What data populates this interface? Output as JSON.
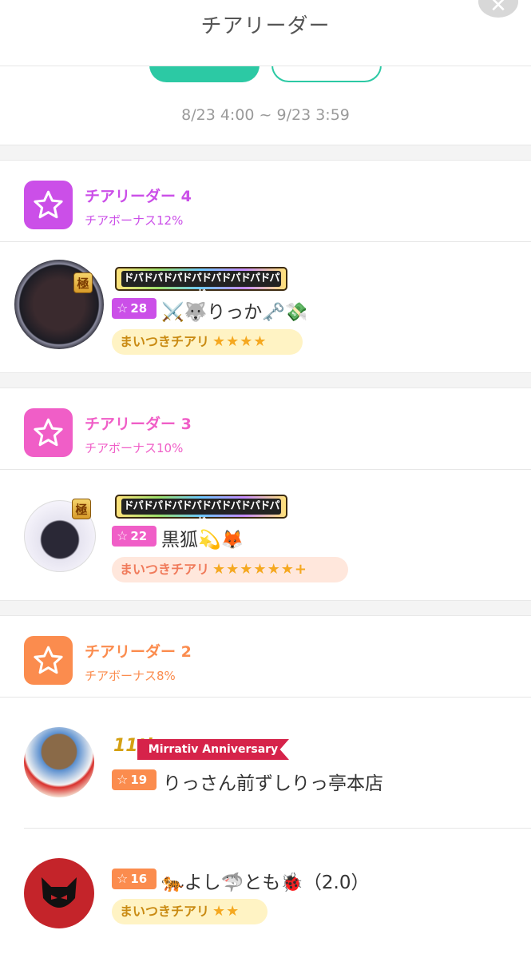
{
  "header": {
    "title": "チアリーダー"
  },
  "period": "8/23 4:00 ~ 9/23 3:59",
  "colors": {
    "accent": "#2cc9a4",
    "tier4": "#cb4fe8",
    "tier3": "#f05ec7",
    "tier2": "#fb8c4e"
  },
  "tiers": [
    {
      "name": "チアリーダー 4",
      "bonus": "チアボーナス12%",
      "icon": "star-icon",
      "users": [
        {
          "badge": "ドパドパドパドパドパドパドパドパド",
          "level": "28",
          "name": "⚔️🐺りっか🗝️💸",
          "tag": "まいつきチアリ",
          "tag_stars": "★★★★"
        }
      ]
    },
    {
      "name": "チアリーダー 3",
      "bonus": "チアボーナス10%",
      "icon": "star-icon",
      "users": [
        {
          "badge": "ドパドパドパドパドパドパドパドパド",
          "level": "22",
          "name": "黒狐💫🦊",
          "tag": "まいつきチアリ",
          "tag_stars": "★★★★★★+"
        }
      ]
    },
    {
      "name": "チアリーダー 2",
      "bonus": "チアボーナス8%",
      "icon": "star-icon",
      "users": [
        {
          "badge_num": "11th",
          "badge": "Mirrativ Anniversary",
          "level": "19",
          "name": "りっさん前ずしりっ亭本店"
        },
        {
          "level": "16",
          "name": "🐅よし🦈とも🐞（2.0）",
          "tag": "まいつきチアリ",
          "tag_stars": "★★"
        }
      ]
    }
  ],
  "level_star": "☆",
  "kiwami": "極"
}
